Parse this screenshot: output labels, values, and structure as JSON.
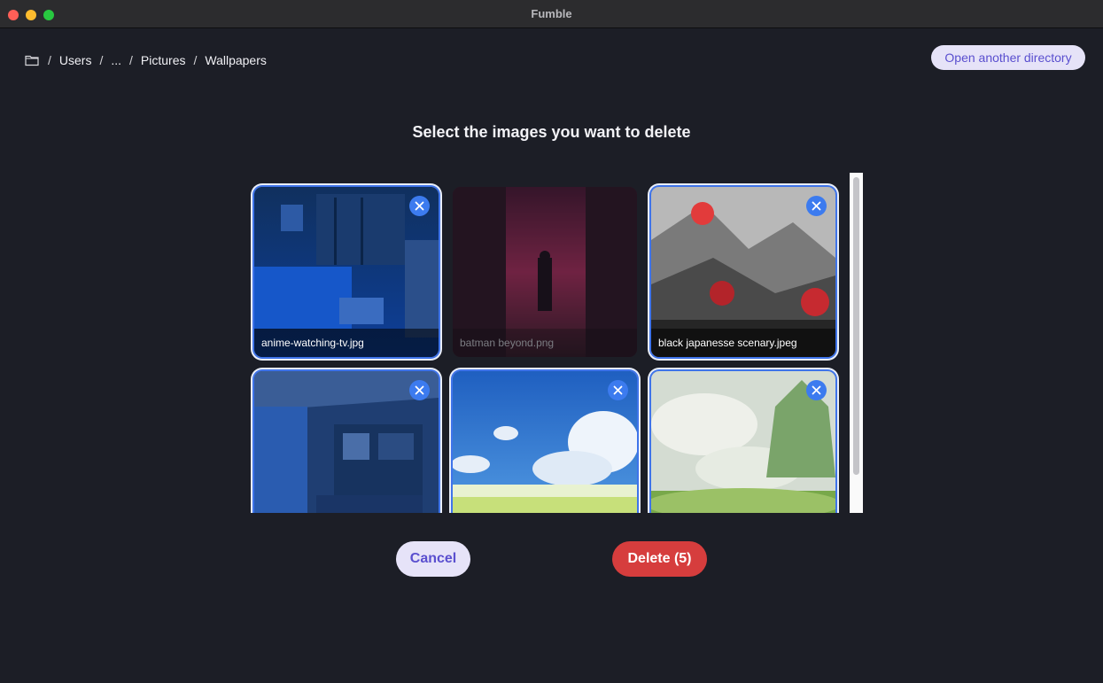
{
  "window": {
    "title": "Fumble"
  },
  "breadcrumb": {
    "icon": "folder-icon",
    "items": [
      "Users",
      "...",
      "Pictures",
      "Wallpapers"
    ],
    "separator": "/"
  },
  "toolbar": {
    "open_another_label": "Open another directory"
  },
  "main": {
    "heading": "Select the images you want to delete"
  },
  "images": [
    {
      "filename": "anime-watching-tv.jpg",
      "selected": true
    },
    {
      "filename": "batman beyond.png",
      "selected": false
    },
    {
      "filename": "black japanesse scenary.jpeg",
      "selected": true
    },
    {
      "filename": "",
      "selected": true
    },
    {
      "filename": "",
      "selected": true
    },
    {
      "filename": "",
      "selected": true
    }
  ],
  "actions": {
    "cancel_label": "Cancel",
    "delete_label": "Delete (5)"
  },
  "colors": {
    "background": "#1c1e26",
    "accent": "#3c7bef",
    "danger": "#d63d3d",
    "secondary_button": "#e6e3f8",
    "secondary_text": "#5a4fcf"
  }
}
